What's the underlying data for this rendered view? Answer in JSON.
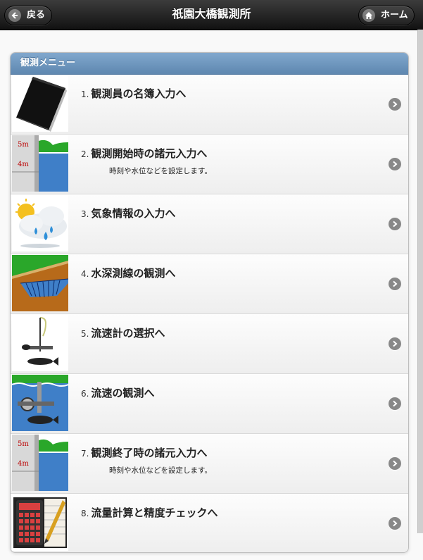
{
  "header": {
    "title": "祇園大橋観測所",
    "back_label": "戻る",
    "home_label": "ホーム"
  },
  "menu": {
    "divider": "観測メニュー",
    "items": [
      {
        "num": "1.",
        "label": "観測員の名簿入力へ",
        "sub": "",
        "icon": "notebook-icon"
      },
      {
        "num": "2.",
        "label": "観測開始時の諸元入力へ",
        "sub": "時刻や水位などを設定します。",
        "icon": "water-gauge-icon"
      },
      {
        "num": "3.",
        "label": "気象情報の入力へ",
        "sub": "",
        "icon": "weather-icon"
      },
      {
        "num": "4.",
        "label": "水深測線の観測へ",
        "sub": "",
        "icon": "river-cross-section-icon"
      },
      {
        "num": "5.",
        "label": "流速計の選択へ",
        "sub": "",
        "icon": "current-meter-icon"
      },
      {
        "num": "6.",
        "label": "流速の観測へ",
        "sub": "",
        "icon": "velocity-measurement-icon"
      },
      {
        "num": "7.",
        "label": "観測終了時の諸元入力へ",
        "sub": "時刻や水位などを設定します。",
        "icon": "water-gauge-icon"
      },
      {
        "num": "8.",
        "label": "流量計算と精度チェックへ",
        "sub": "",
        "icon": "calculator-icon"
      }
    ]
  },
  "gauge_labels": {
    "top": "5m",
    "bottom": "4m"
  }
}
